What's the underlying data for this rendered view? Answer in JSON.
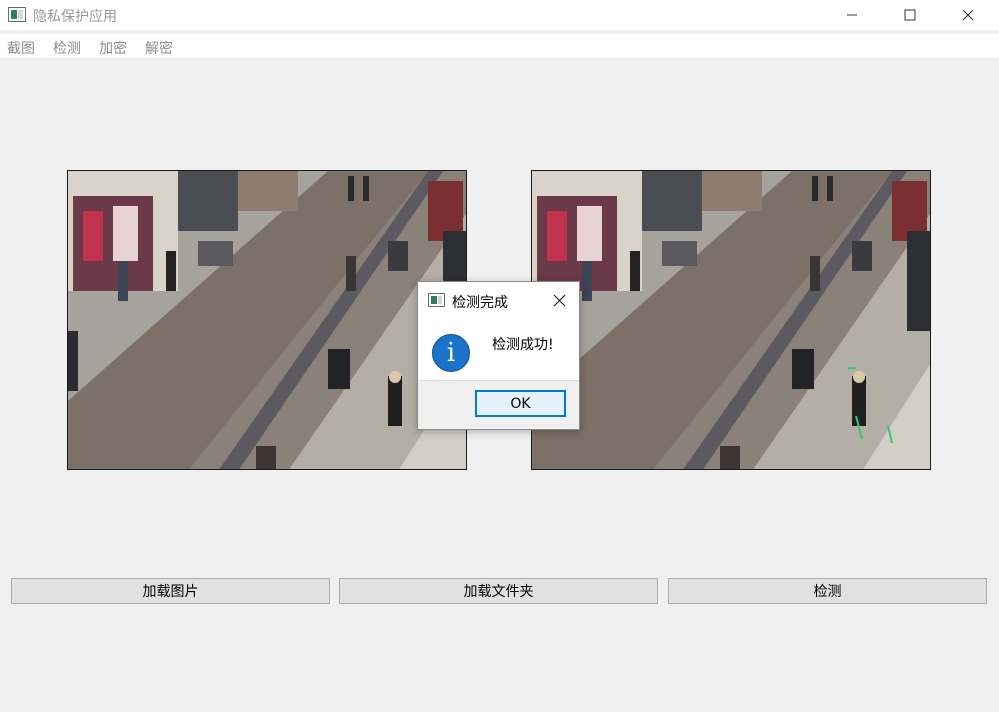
{
  "window": {
    "title": "隐私保护应用",
    "controls": [
      "minimize-icon",
      "maximize-icon",
      "close-icon"
    ]
  },
  "menu": {
    "items": [
      "截图",
      "检测",
      "加密",
      "解密"
    ]
  },
  "images": {
    "left_name": "original-image",
    "right_name": "detected-image"
  },
  "buttons": {
    "load_image": "加载图片",
    "load_folder": "加载文件夹",
    "detect": "检测"
  },
  "dialog": {
    "title": "检测完成",
    "message": "检测成功!",
    "icon": "info-icon",
    "ok_label": "OK"
  },
  "colors": {
    "dialog_accent": "#0078d7",
    "info_icon": "#1a73c9",
    "detection_box": "#2ecc71"
  }
}
